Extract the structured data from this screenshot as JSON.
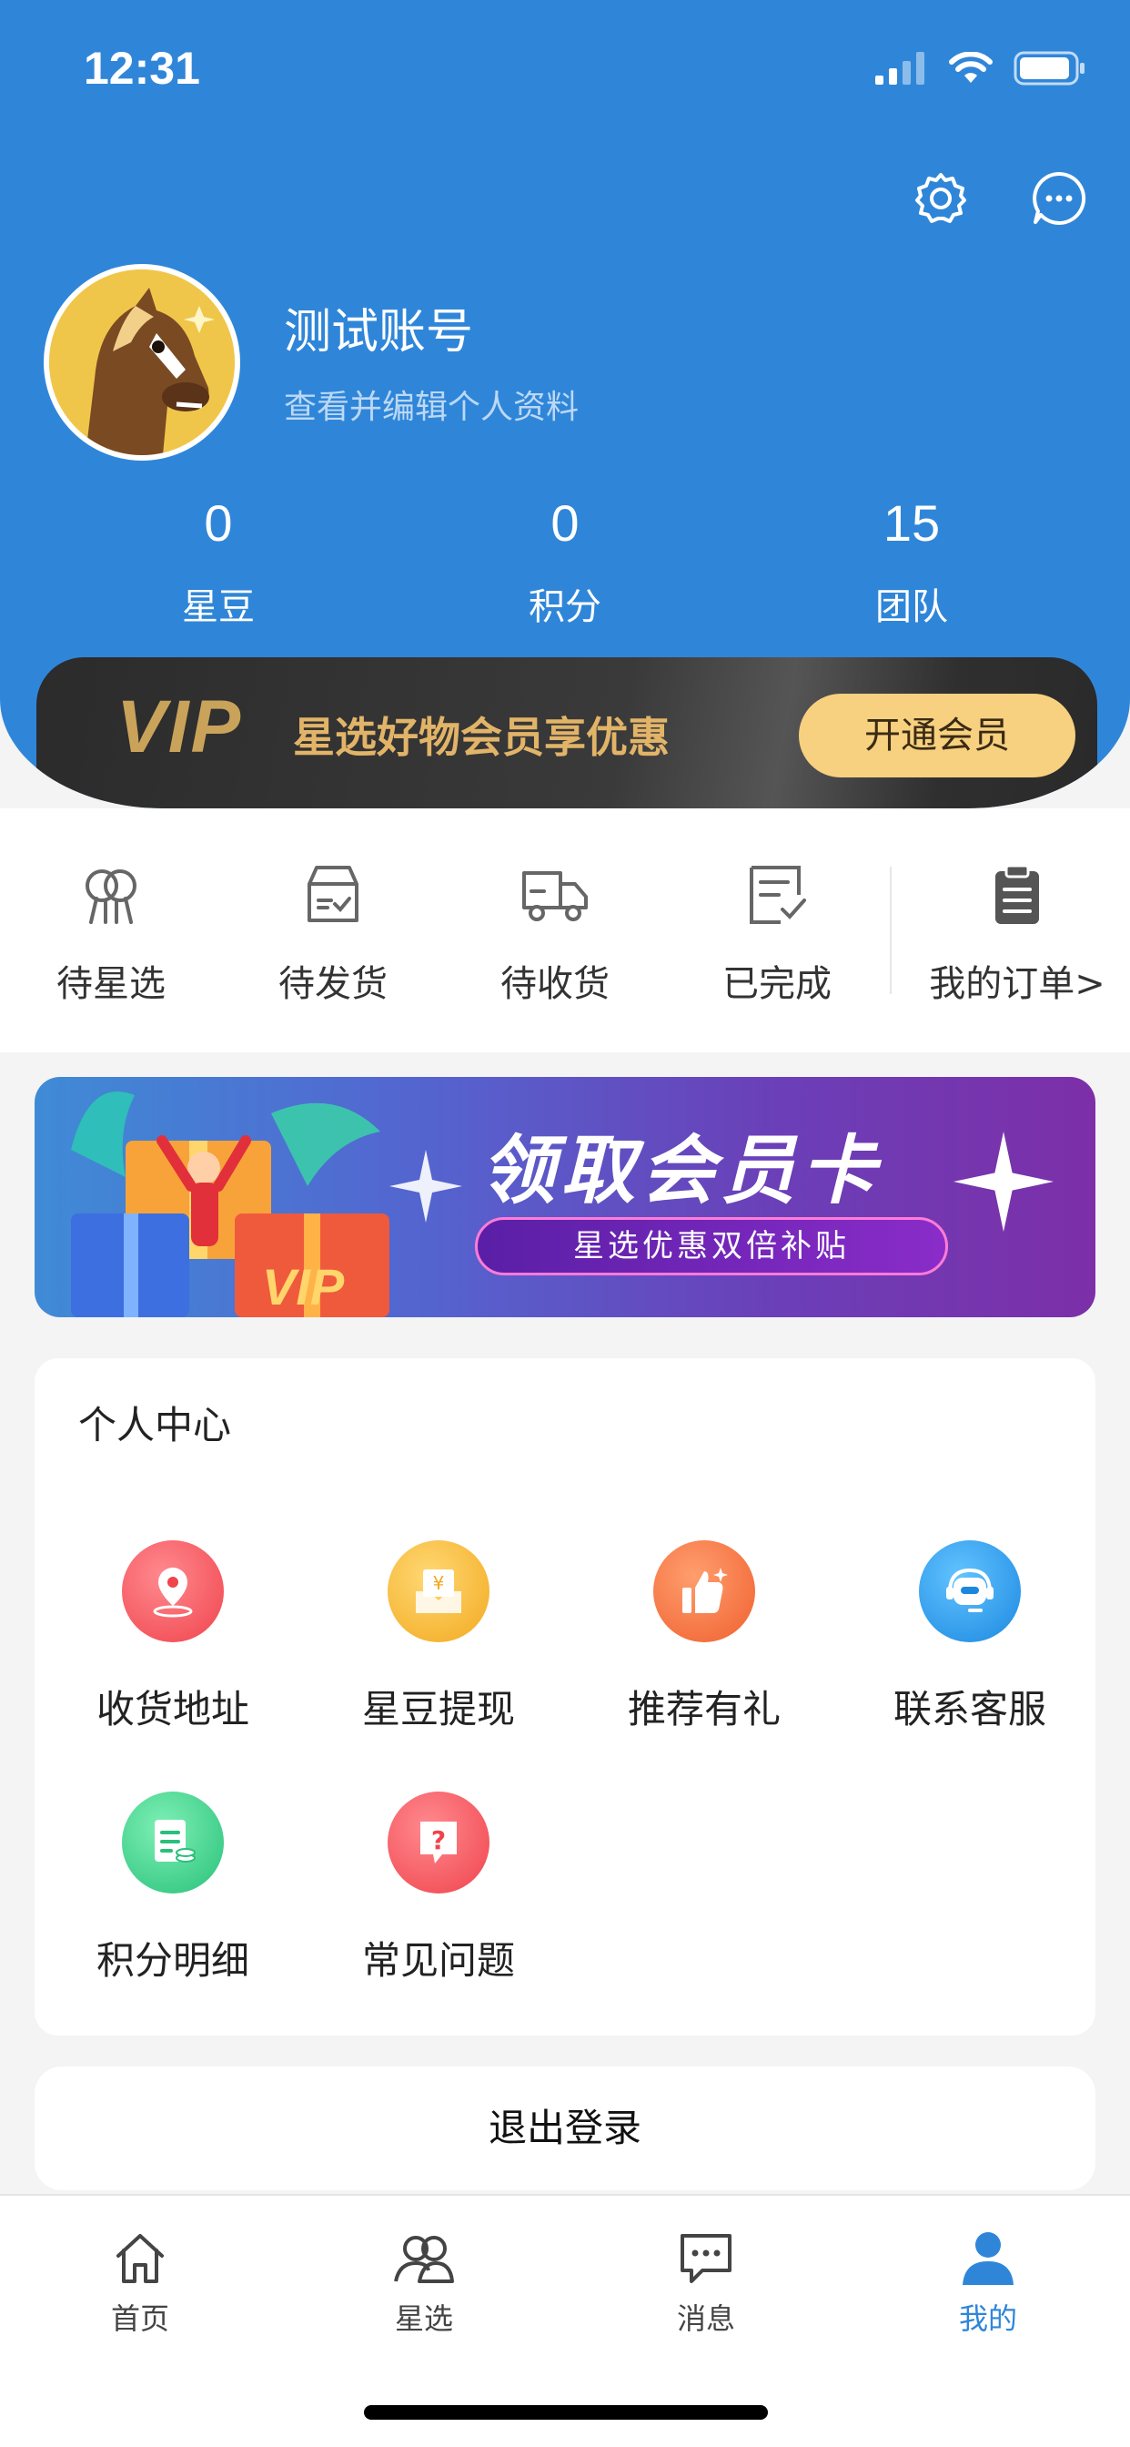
{
  "status_bar": {
    "time": "12:31"
  },
  "profile": {
    "name": "测试账号",
    "subtitle": "查看并编辑个人资料"
  },
  "stats": [
    {
      "value": "0",
      "label": "星豆"
    },
    {
      "value": "0",
      "label": "积分"
    },
    {
      "value": "15",
      "label": "团队"
    }
  ],
  "vip": {
    "logo": "VIP",
    "text": "星选好物会员享优惠",
    "button": "开通会员"
  },
  "orders": [
    {
      "label": "待星选",
      "icon": "pending-select-icon"
    },
    {
      "label": "待发货",
      "icon": "box-icon"
    },
    {
      "label": "待收货",
      "icon": "truck-icon"
    },
    {
      "label": "已完成",
      "icon": "done-doc-icon"
    },
    {
      "label": "我的订单>",
      "icon": "clipboard-icon"
    }
  ],
  "banner": {
    "title": "领取会员卡",
    "pill": "星选优惠双倍补贴"
  },
  "personal_center": {
    "title": "个人中心",
    "items": [
      {
        "label": "收货地址",
        "icon": "location-icon",
        "color": "#f5545c"
      },
      {
        "label": "星豆提现",
        "icon": "withdraw-icon",
        "color": "#f6b93b"
      },
      {
        "label": "推荐有礼",
        "icon": "thumbs-up-icon",
        "color": "#f6744a"
      },
      {
        "label": "联系客服",
        "icon": "headset-icon",
        "color": "#2f9be8"
      },
      {
        "label": "积分明细",
        "icon": "points-doc-icon",
        "color": "#3ccf8e"
      },
      {
        "label": "常见问题",
        "icon": "question-icon",
        "color": "#f5545c"
      }
    ]
  },
  "logout": "退出登录",
  "tabs": [
    {
      "label": "首页",
      "icon": "home-icon"
    },
    {
      "label": "星选",
      "icon": "group-icon"
    },
    {
      "label": "消息",
      "icon": "message-icon"
    },
    {
      "label": "我的",
      "icon": "user-icon",
      "active": true
    }
  ],
  "colors": {
    "primary": "#2f86d9",
    "vip_gold": "#f7d17f"
  }
}
